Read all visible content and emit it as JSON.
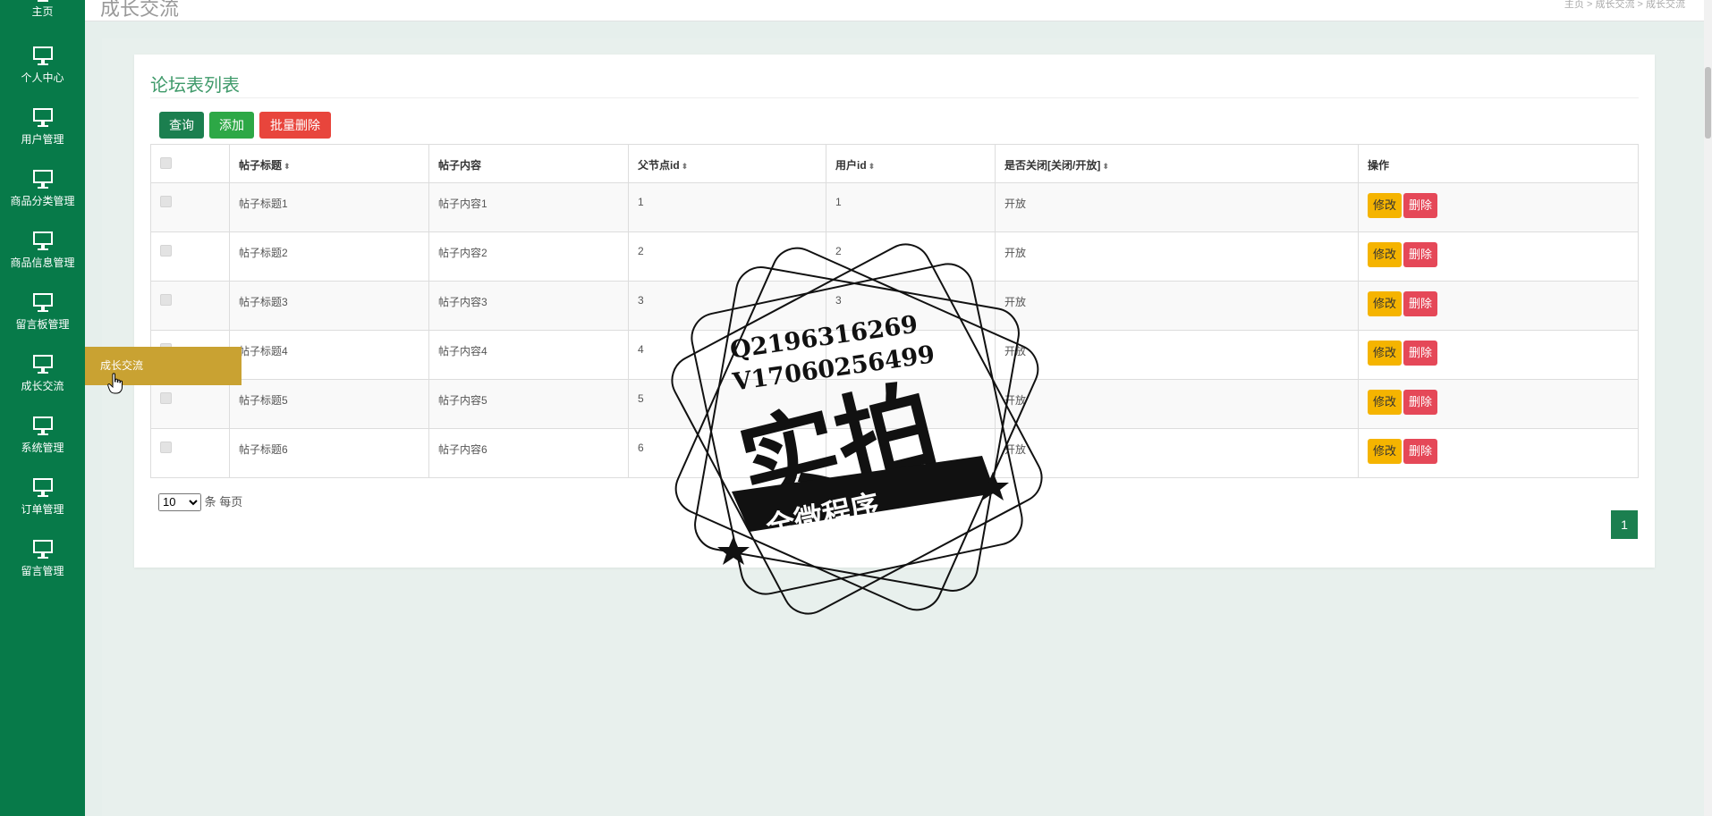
{
  "sidebar": {
    "items": [
      {
        "label": "主页"
      },
      {
        "label": "个人中心"
      },
      {
        "label": "用户管理"
      },
      {
        "label": "商品分类管理"
      },
      {
        "label": "商品信息管理"
      },
      {
        "label": "留言板管理"
      },
      {
        "label": "成长交流"
      },
      {
        "label": "系统管理"
      },
      {
        "label": "订单管理"
      },
      {
        "label": "留言管理"
      }
    ],
    "flyout": "成长交流"
  },
  "header": {
    "title": "成长交流",
    "breadcrumb": "主页 > 成长交流 > 成长交流"
  },
  "card": {
    "title": "论坛表列表",
    "buttons": {
      "query": "查询",
      "add": "添加",
      "bulk_delete": "批量删除"
    }
  },
  "table": {
    "headers": [
      "帖子标题",
      "帖子内容",
      "父节点id",
      "用户id",
      "是否关闭[关闭/开放]",
      "操作"
    ],
    "rows": [
      {
        "title": "帖子标题1",
        "content": "帖子内容1",
        "parent_id": "1",
        "user_id": "1",
        "status": "开放"
      },
      {
        "title": "帖子标题2",
        "content": "帖子内容2",
        "parent_id": "2",
        "user_id": "2",
        "status": "开放"
      },
      {
        "title": "帖子标题3",
        "content": "帖子内容3",
        "parent_id": "3",
        "user_id": "3",
        "status": "开放"
      },
      {
        "title": "帖子标题4",
        "content": "帖子内容4",
        "parent_id": "4",
        "user_id": "",
        "status": "开放"
      },
      {
        "title": "帖子标题5",
        "content": "帖子内容5",
        "parent_id": "5",
        "user_id": "",
        "status": "开放"
      },
      {
        "title": "帖子标题6",
        "content": "帖子内容6",
        "parent_id": "6",
        "user_id": "",
        "status": "开放"
      }
    ],
    "actions": {
      "edit": "修改",
      "delete": "删除"
    }
  },
  "pager": {
    "page_size": "10",
    "unit": "条 每页",
    "current_page": "1"
  },
  "stamp": {
    "line1": "Q2196316269",
    "line2": "V17060256499",
    "main": "实拍",
    "banner": "全微程序"
  }
}
